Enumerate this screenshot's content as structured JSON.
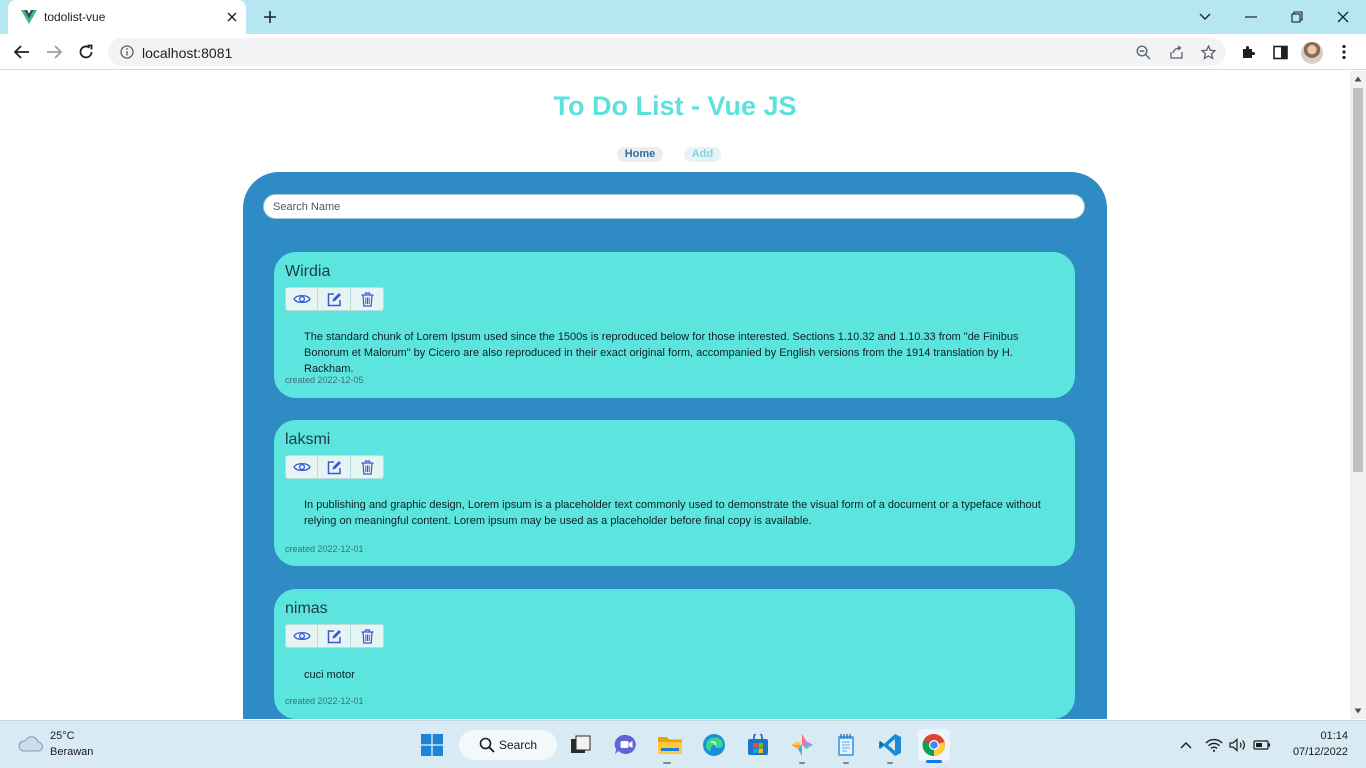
{
  "browser": {
    "tab_title": "todolist-vue",
    "url": "localhost:8081"
  },
  "app": {
    "title": "To Do List - Vue JS",
    "nav": {
      "home": "Home",
      "add": "Add"
    },
    "search_placeholder": "Search Name",
    "todos": [
      {
        "name": "Wirdia",
        "description": "The standard chunk of Lorem Ipsum used since the 1500s is reproduced below for those interested. Sections 1.10.32 and 1.10.33 from \"de Finibus Bonorum et Malorum\" by Cicero are also reproduced in their exact original form, accompanied by English versions from the 1914 translation by H. Rackham.",
        "created": "created 2022-12-05"
      },
      {
        "name": "laksmi",
        "description": "In publishing and graphic design, Lorem ipsum is a placeholder text commonly used to demonstrate the visual form of a document or a typeface without relying on meaningful content. Lorem ipsum may be used as a placeholder before final copy is available.",
        "created": "created 2022-12-01"
      },
      {
        "name": "nimas",
        "description": "cuci motor",
        "created": "created 2022-12-01"
      }
    ]
  },
  "taskbar": {
    "weather_temp": "25°C",
    "weather_desc": "Berawan",
    "search_label": "Search",
    "time": "01:14",
    "date": "07/12/2022"
  },
  "colors": {
    "accent": "#5ce1dc",
    "panel": "#2f8bc4",
    "card": "#5ce5df",
    "icon": "#3b57d6"
  }
}
